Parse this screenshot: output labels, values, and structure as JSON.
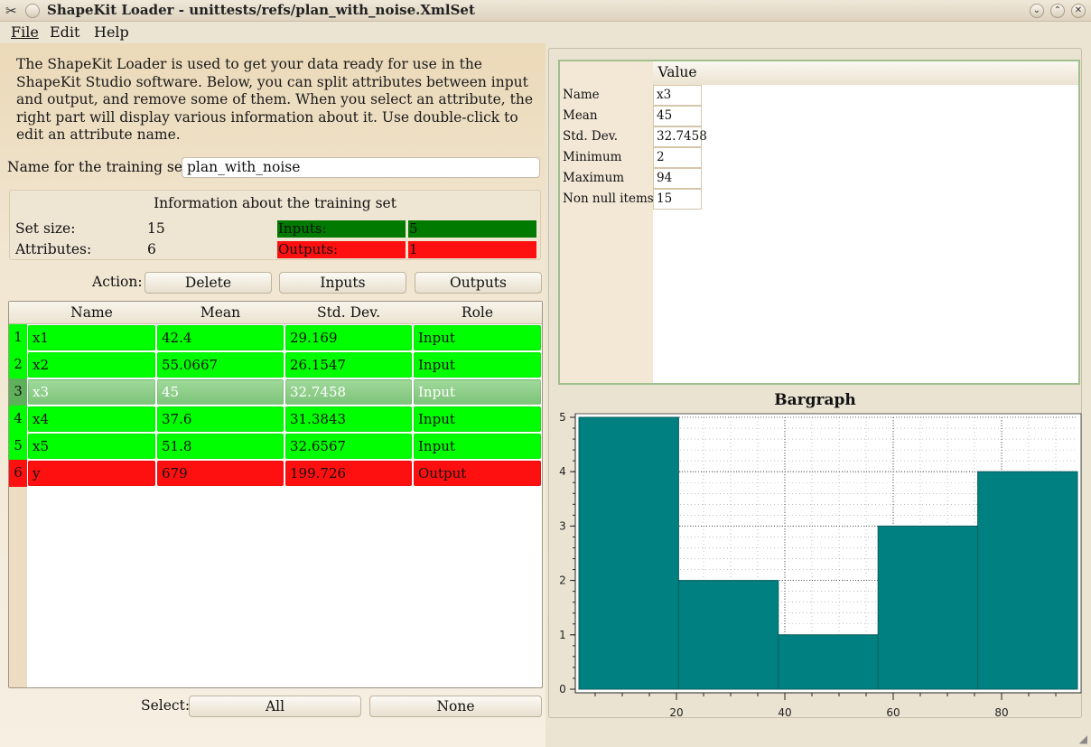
{
  "window": {
    "title": "ShapeKit Loader - unittests/refs/plan_with_noise.XmlSet"
  },
  "menu": {
    "file": "File",
    "edit": "Edit",
    "help": "Help"
  },
  "description": "The ShapeKit Loader is used to get your data ready for use in the ShapeKit Studio software. Below, you can split attributes between input and output, and remove some of them. When you select an attribute, the right part will display various information about it. Use double-click to edit an attribute name.",
  "training_set": {
    "label": "Name for the training set:",
    "value": "plan_with_noise"
  },
  "info": {
    "title": "Information about the training set",
    "set_size_label": "Set size:",
    "set_size": "15",
    "attributes_label": "Attributes:",
    "attributes": "6",
    "inputs_label": "Inputs:",
    "inputs": "5",
    "outputs_label": "Outputs:",
    "outputs": "1",
    "inputs_color": "#007a00",
    "outputs_color": "#ff1010"
  },
  "actions": {
    "label": "Action:",
    "delete": "Delete",
    "inputs": "Inputs",
    "outputs": "Outputs"
  },
  "table": {
    "headers": [
      "Name",
      "Mean",
      "Std. Dev.",
      "Role"
    ],
    "rows": [
      {
        "num": "1",
        "name": "x1",
        "mean": "42.4",
        "std": "29.169",
        "role": "Input"
      },
      {
        "num": "2",
        "name": "x2",
        "mean": "55.0667",
        "std": "26.1547",
        "role": "Input"
      },
      {
        "num": "3",
        "name": "x3",
        "mean": "45",
        "std": "32.7458",
        "role": "Input"
      },
      {
        "num": "4",
        "name": "x4",
        "mean": "37.6",
        "std": "31.3843",
        "role": "Input"
      },
      {
        "num": "5",
        "name": "x5",
        "mean": "51.8",
        "std": "32.6567",
        "role": "Input"
      },
      {
        "num": "6",
        "name": "y",
        "mean": "679",
        "std": "199.726",
        "role": "Output"
      }
    ],
    "selected_row": "3",
    "input_color": "#00ff00",
    "output_color": "#ff1010"
  },
  "select": {
    "label": "Select:",
    "all": "All",
    "none": "None"
  },
  "properties": {
    "header": "Value",
    "rows": [
      {
        "name": "Name",
        "value": "x3"
      },
      {
        "name": "Mean",
        "value": "45"
      },
      {
        "name": "Std. Dev.",
        "value": "32.7458"
      },
      {
        "name": "Minimum",
        "value": "2"
      },
      {
        "name": "Maximum",
        "value": "94"
      },
      {
        "name": "Non null items",
        "value": "15"
      }
    ]
  },
  "chart_data": {
    "type": "bar",
    "title": "Bargraph",
    "bins": [
      [
        2,
        20.4
      ],
      [
        20.4,
        38.8
      ],
      [
        38.8,
        57.2
      ],
      [
        57.2,
        75.6
      ],
      [
        75.6,
        94
      ]
    ],
    "values": [
      5,
      2,
      1,
      3,
      4
    ],
    "xlim": [
      2,
      94
    ],
    "ylim": [
      0,
      5
    ],
    "xticks": [
      20,
      40,
      60,
      80
    ],
    "yticks": [
      0,
      1,
      2,
      3,
      4,
      5
    ],
    "bar_color": "#008080",
    "grid": true
  }
}
